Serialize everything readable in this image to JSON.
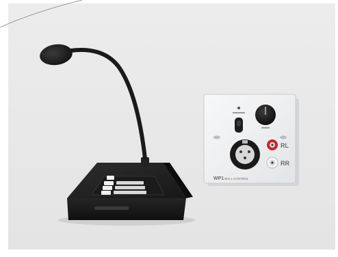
{
  "product_photo": {
    "background_color": "#e9e9e9",
    "microphone": {
      "color": "#1f1f1f",
      "zone_buttons_color": "#f2f2f2"
    },
    "wall_plate": {
      "plate_color": "#eef0f1",
      "model_label": "WP1",
      "caption_label": "WALL CONTROL",
      "jack_labels": {
        "red": "RL",
        "white": "RR"
      },
      "colors": {
        "red_jack": "#c1272d",
        "white_jack": "#f5f5f5"
      }
    }
  }
}
